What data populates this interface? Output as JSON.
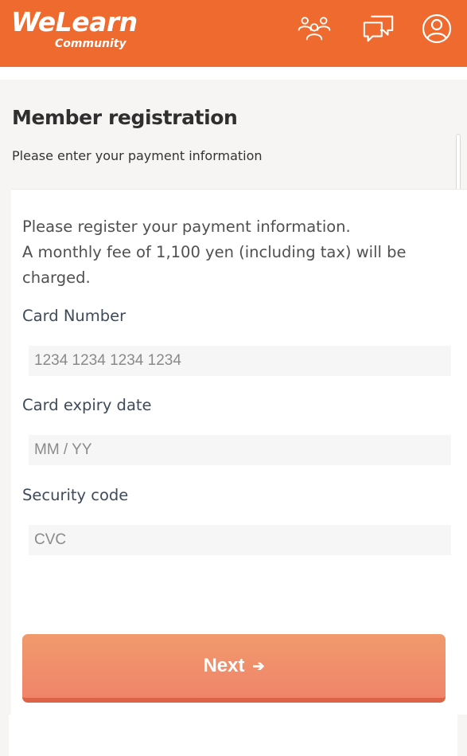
{
  "header": {
    "logo_main": "WeLearn",
    "logo_sub": "Community",
    "icons": [
      "community-members-icon",
      "chat-icon",
      "account-icon"
    ],
    "brand_color": "#ef6a2f"
  },
  "page": {
    "title": "Member registration",
    "subtitle": "Please enter your payment information"
  },
  "form": {
    "intro_line1": "Please register your payment information.",
    "intro_line2": "A monthly fee of 1,100 yen (including tax) will be",
    "intro_line3": "charged.",
    "card_number": {
      "label": "Card Number",
      "placeholder": "1234 1234 1234 1234"
    },
    "expiry": {
      "label": "Card expiry date",
      "placeholder": "MM / YY"
    },
    "security": {
      "label": "Security code",
      "placeholder": "CVC"
    },
    "next_label": "Next",
    "next_icon": "arrow-right-icon"
  }
}
